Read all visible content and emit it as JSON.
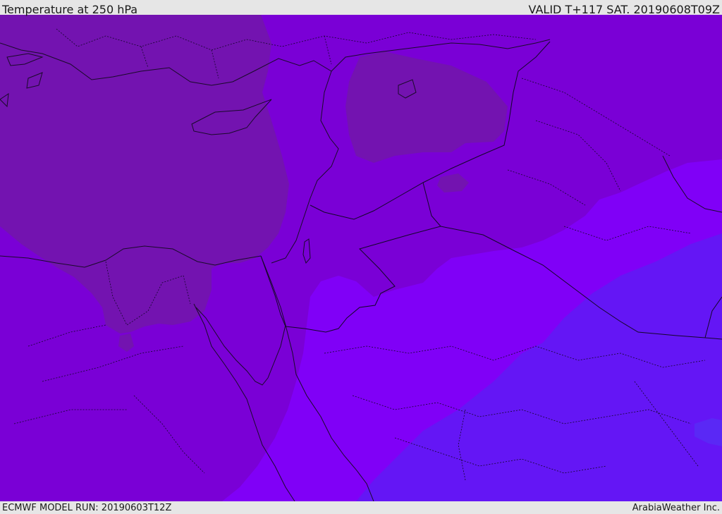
{
  "header": {
    "title": "Temperature at 250 hPa",
    "valid_time": "VALID T+117 SAT. 20190608T09Z"
  },
  "footer": {
    "model_run": "ECMWF MODEL RUN: 20190603T12Z",
    "credit": "ArabiaWeather Inc."
  },
  "map": {
    "colors": {
      "warmest_band": "#7313b0",
      "warm_band": "#7a00d6",
      "mid_band": "#8000f7",
      "cool_band": "#6416f5",
      "coolest_patch": "#5a28f5",
      "coastline": "#1a0a2a",
      "border": "#14062a"
    }
  }
}
